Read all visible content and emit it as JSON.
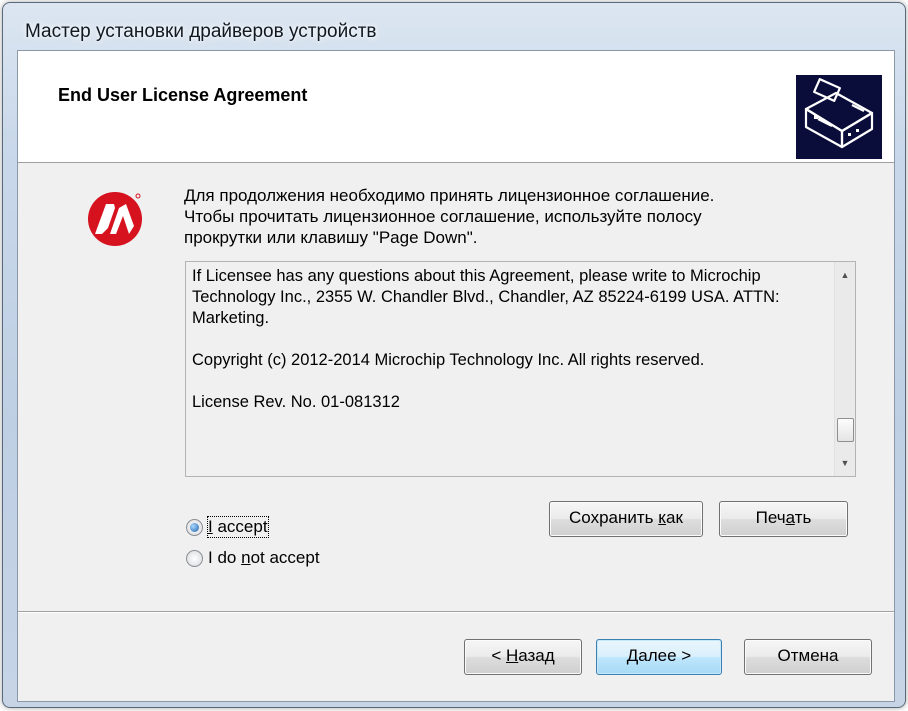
{
  "window": {
    "title": "Мастер установки драйверов устройств"
  },
  "header": {
    "title": "End User License Agreement",
    "icon": "hardware-install-icon"
  },
  "logo": {
    "icon": "microchip-logo-icon",
    "color": "#d6121f"
  },
  "intro": {
    "line1": "Для продолжения необходимо принять лицензионное соглашение.",
    "line2": "Чтобы прочитать лицензионное соглашение, используйте полосу",
    "line3": "прокрутки или клавишу \"Page Down\"."
  },
  "license": {
    "paragraph1": "If Licensee has any questions about this Agreement, please write to Microchip Technology Inc., 2355 W. Chandler Blvd., Chandler, AZ 85224-6199 USA. ATTN: Marketing.",
    "paragraph2": "Copyright (c) 2012-2014 Microchip Technology Inc.  All rights reserved.",
    "paragraph3": "License Rev. No. 01-081312",
    "scroll_up_glyph": "▲",
    "scroll_down_glyph": "▼"
  },
  "actions": {
    "save_as_pre": "Сохранить ",
    "save_as_accel": "к",
    "save_as_post": "ак",
    "print_pre": "Печ",
    "print_accel": "а",
    "print_post": "ть"
  },
  "radios": {
    "accept_accel": "I",
    "accept_rest": " accept",
    "accept_checked": true,
    "decline_pre": "I do ",
    "decline_accel": "n",
    "decline_rest": "ot accept",
    "decline_checked": false
  },
  "nav": {
    "back_pre": "< ",
    "back_accel": "Н",
    "back_post": "азад",
    "next_label": "Далее >",
    "cancel_label": "Отмена"
  }
}
